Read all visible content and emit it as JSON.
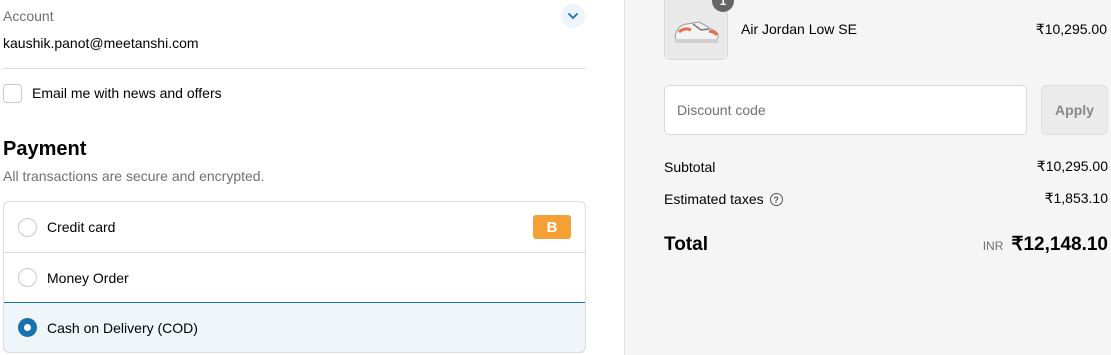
{
  "account": {
    "label": "Account",
    "email": "kaushik.panot@meetanshi.com",
    "chevron_icon": "chevron-down-icon"
  },
  "newsletter": {
    "label": "Email me with news and offers",
    "checked": false
  },
  "payment": {
    "title": "Payment",
    "subtitle": "All transactions are secure and encrypted.",
    "methods": [
      {
        "label": "Credit card",
        "selected": false,
        "badge": "B"
      },
      {
        "label": "Money Order",
        "selected": false
      },
      {
        "label": "Cash on Delivery (COD)",
        "selected": true
      }
    ]
  },
  "order": {
    "item": {
      "name": "Air Jordan Low SE",
      "price": "₹10,295.00",
      "quantity": "1"
    },
    "discount": {
      "placeholder": "Discount code",
      "apply_label": "Apply"
    },
    "subtotal_label": "Subtotal",
    "subtotal_value": "₹10,295.00",
    "taxes_label": "Estimated taxes",
    "taxes_value": "₹1,853.10",
    "total_label": "Total",
    "currency": "INR",
    "total_value": "₹12,148.10"
  },
  "colors": {
    "accent": "#1773b0",
    "badge": "#f5a035",
    "summary_bg": "#f5f5f5"
  }
}
